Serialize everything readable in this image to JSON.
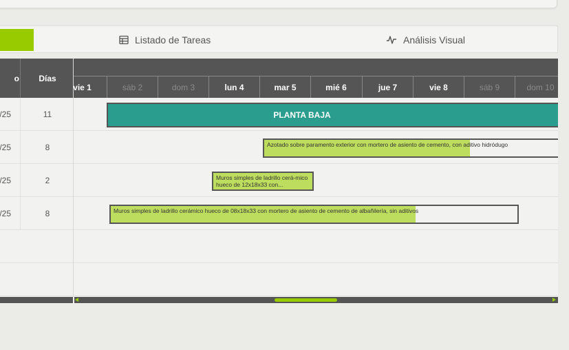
{
  "tabs": [
    {
      "label": "Listado de Tareas",
      "icon": "table-icon"
    },
    {
      "label": "Análisis Visual",
      "icon": "activity-icon"
    }
  ],
  "grid": {
    "headers": {
      "date": "o",
      "days": "Días"
    },
    "rows": [
      {
        "date": "/25",
        "days": "11"
      },
      {
        "date": "/25",
        "days": "8"
      },
      {
        "date": "/25",
        "days": "2"
      },
      {
        "date": "/25",
        "days": "8"
      }
    ]
  },
  "timeline": {
    "days": [
      {
        "label": "vie 1",
        "weekend": false
      },
      {
        "label": "sáb 2",
        "weekend": true
      },
      {
        "label": "dom 3",
        "weekend": true
      },
      {
        "label": "lun 4",
        "weekend": false
      },
      {
        "label": "mar 5",
        "weekend": false
      },
      {
        "label": "mié 6",
        "weekend": false
      },
      {
        "label": "jue 7",
        "weekend": false
      },
      {
        "label": "vie 8",
        "weekend": false
      },
      {
        "label": "sáb 9",
        "weekend": true
      },
      {
        "label": "dom 10",
        "weekend": true
      }
    ]
  },
  "bars": {
    "summary": {
      "label": "PLANTA BAJA"
    },
    "task1": {
      "label": "Azotado sobre paramento exterior con mortero de asiento de cemento, con aditivo hidródugo",
      "progress": 0.7
    },
    "task2": {
      "label": "Muros simples de ladrillo cerá-mico hueco de 12x18x33 con...",
      "progress": 1.0
    },
    "task3": {
      "label": "Muros simples de ladrillo cerámico hueco de 08x18x33 con mortero de asiento de cemento de albañilería, sin aditivos",
      "progress": 0.75
    }
  },
  "colors": {
    "accent": "#99cc00",
    "summary": "#2a9d8f",
    "progress": "#bddd5e",
    "header": "#555555"
  }
}
